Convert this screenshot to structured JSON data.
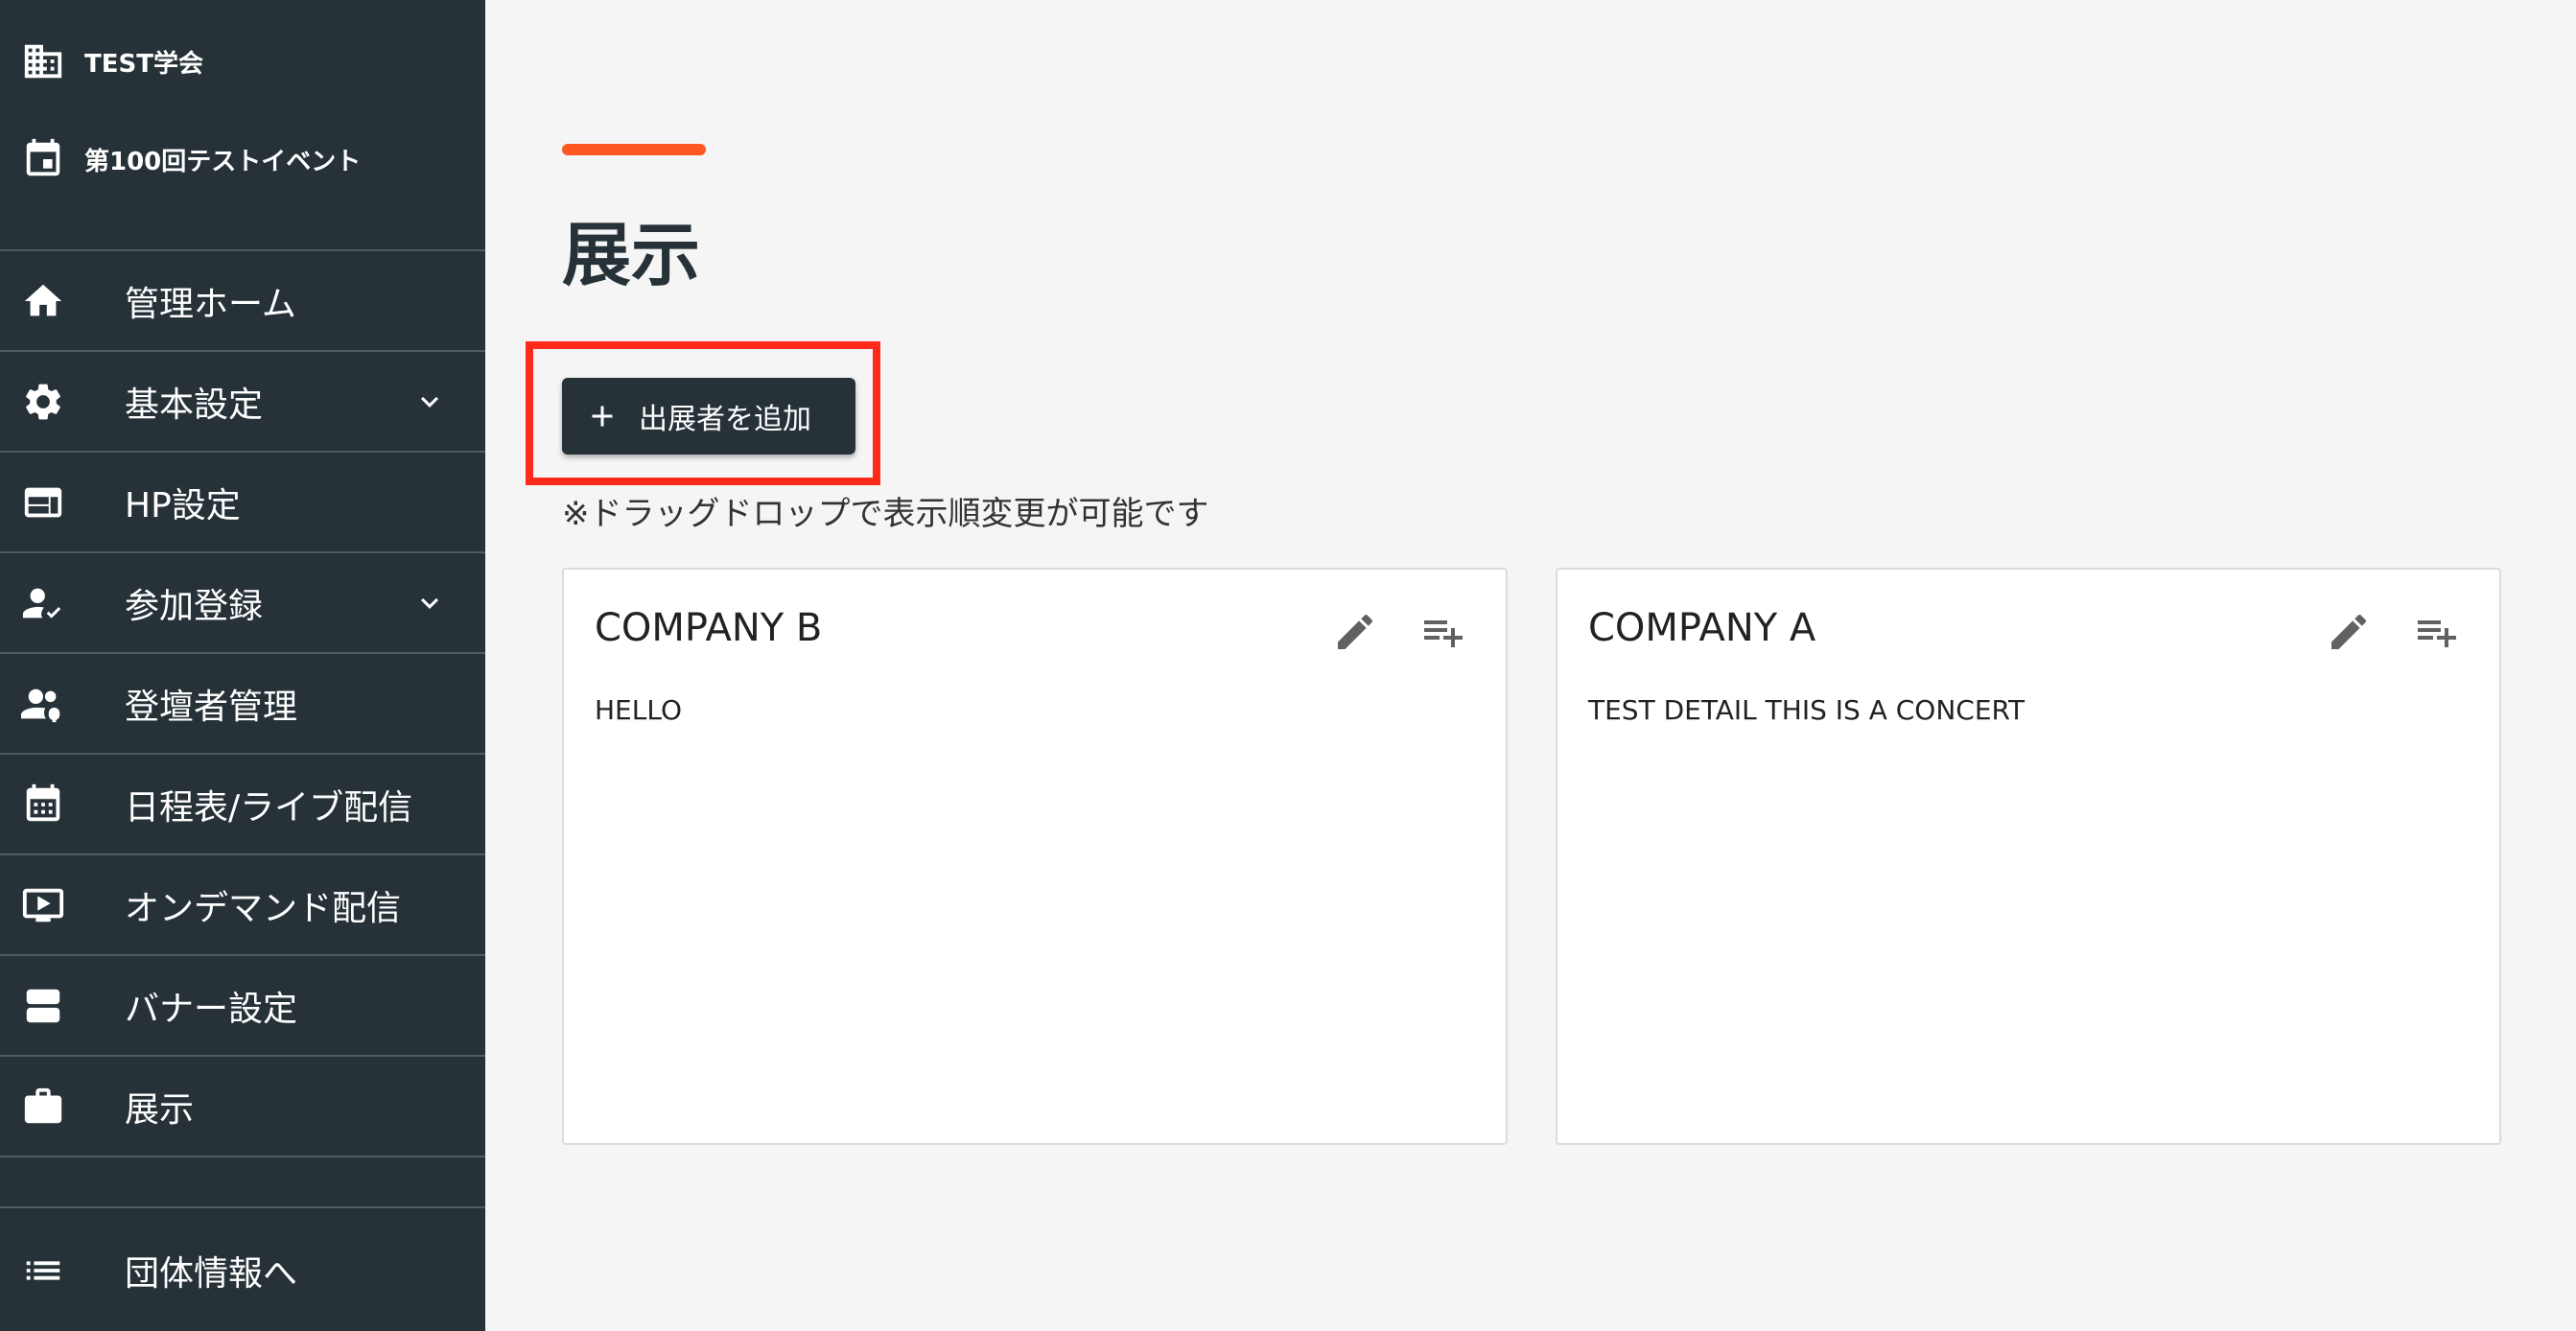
{
  "sidebar": {
    "org_name": "TEST学会",
    "event_name": "第100回テストイベント",
    "items": [
      {
        "label": "管理ホーム",
        "icon": "home-icon",
        "expandable": false
      },
      {
        "label": "基本設定",
        "icon": "gear-icon",
        "expandable": true
      },
      {
        "label": "HP設定",
        "icon": "web-layout-icon",
        "expandable": false
      },
      {
        "label": "参加登録",
        "icon": "person-check-icon",
        "expandable": true
      },
      {
        "label": "登壇者管理",
        "icon": "speaker-group-icon",
        "expandable": false
      },
      {
        "label": "日程表/ライブ配信",
        "icon": "calendar-grid-icon",
        "expandable": false
      },
      {
        "label": "オンデマンド配信",
        "icon": "video-play-icon",
        "expandable": false
      },
      {
        "label": "バナー設定",
        "icon": "banner-icon",
        "expandable": false
      },
      {
        "label": "展示",
        "icon": "briefcase-icon",
        "expandable": false
      }
    ],
    "bottom_item": {
      "label": "団体情報へ",
      "icon": "list-icon"
    }
  },
  "main": {
    "title": "展示",
    "add_button_label": "出展者を追加",
    "hint": "※ドラッグドロップで表示順変更が可能です",
    "cards": [
      {
        "title": "COMPANY B",
        "detail": "HELLO"
      },
      {
        "title": "COMPANY A",
        "detail": "TEST DETAIL THIS IS A CONCERT"
      }
    ]
  },
  "colors": {
    "sidebar_bg": "#263238",
    "accent": "#ff5722",
    "highlight": "#ff2a1a",
    "page_bg": "#f5f5f5"
  }
}
